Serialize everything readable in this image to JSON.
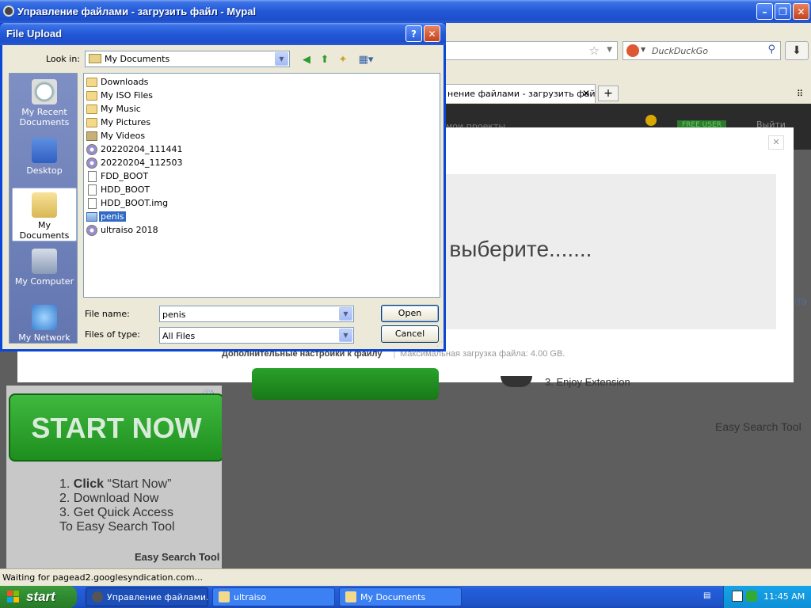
{
  "browser": {
    "title": "Управление файлами - загрузить файл - Mypal",
    "search_placeholder": "DuckDuckGo",
    "tab_title": "нение файлами - загрузить файл",
    "status": "Waiting for pagead2.googlesyndication.com..."
  },
  "page": {
    "menu_text": "мои проекты",
    "badge": "FREE USER",
    "logout": "Выйти",
    "dropzone_text": "и выберите.......",
    "advanced_settings": "Дополнительные настройки к файлу",
    "separator": "|",
    "max_upload": "Максимальная загрузка файла: 4.00 GB.",
    "ad_left": {
      "button": "START NOW",
      "step1_prefix": "1. ",
      "step1_bold": "Click",
      "step1_rest": " “Start Now”",
      "step2": "2. Download Now",
      "step3": "3. Get Quick Access",
      "step3b": "To Easy Search Tool",
      "footer": "Easy Search Tool"
    },
    "ad_right": {
      "step": "3. Enjoy Extension",
      "footer": "Easy Search Tool"
    }
  },
  "dialog": {
    "title": "File Upload",
    "look_in_label": "Look in:",
    "look_in_value": "My Documents",
    "places": [
      {
        "label": "My Recent Documents"
      },
      {
        "label": "Desktop"
      },
      {
        "label": "My Documents"
      },
      {
        "label": "My Computer"
      },
      {
        "label": "My Network"
      }
    ],
    "files": [
      {
        "name": "Downloads",
        "icon": "folder"
      },
      {
        "name": "My ISO Files",
        "icon": "folder"
      },
      {
        "name": "My Music",
        "icon": "folder"
      },
      {
        "name": "My Pictures",
        "icon": "folder"
      },
      {
        "name": "My Videos",
        "icon": "folder"
      },
      {
        "name": "20220204_111441",
        "icon": "disc"
      },
      {
        "name": "20220204_112503",
        "icon": "disc"
      },
      {
        "name": "FDD_BOOT",
        "icon": "file"
      },
      {
        "name": "HDD_BOOT",
        "icon": "file"
      },
      {
        "name": "HDD_BOOT.img",
        "icon": "file"
      },
      {
        "name": "penis",
        "icon": "image"
      },
      {
        "name": "ultraiso 2018",
        "icon": "disc"
      }
    ],
    "selected_file": "penis",
    "file_name_label": "File name:",
    "file_name_value": "penis",
    "file_type_label": "Files of type:",
    "file_type_value": "All Files",
    "open_label": "Open",
    "cancel_label": "Cancel"
  },
  "taskbar": {
    "start_label": "start",
    "tasks": [
      {
        "label": "Управление файлами..."
      },
      {
        "label": "ultraiso"
      },
      {
        "label": "My Documents"
      }
    ],
    "clock": "11:45 AM"
  }
}
